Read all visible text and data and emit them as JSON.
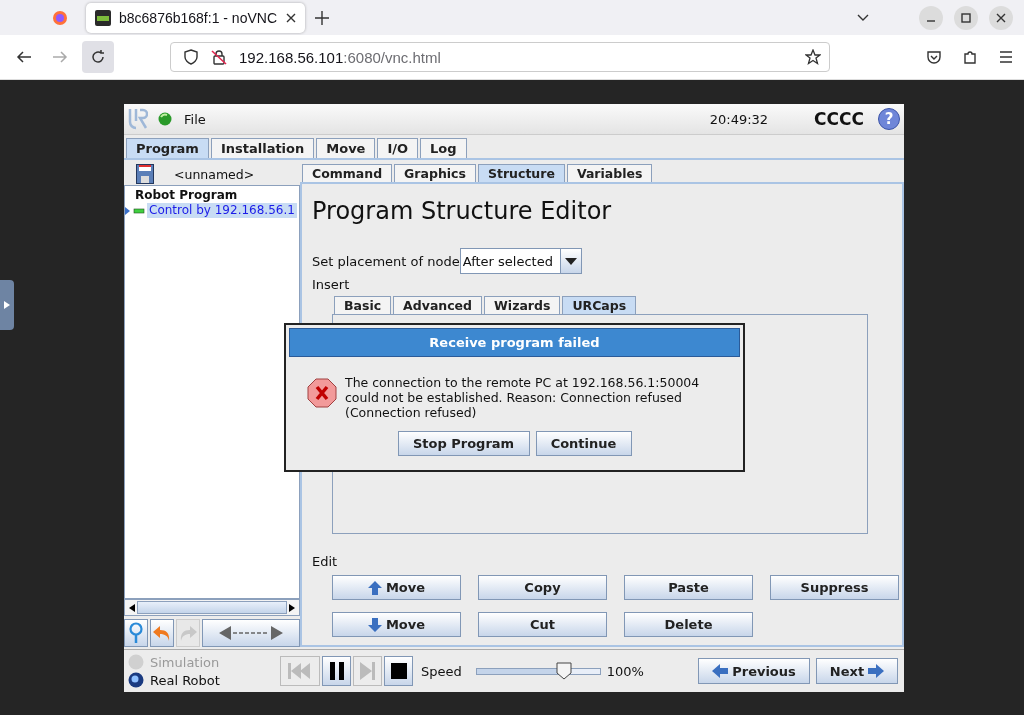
{
  "browser": {
    "tab_title": "b8c6876b168f:1 - noVNC",
    "url_host": "192.168.56.101",
    "url_rest": ":6080/vnc.html"
  },
  "header": {
    "menu": "File",
    "time": "20:49:32",
    "robot_name": "CCCC",
    "help": "?"
  },
  "main_tabs": [
    {
      "label": "Program",
      "selected": true
    },
    {
      "label": "Installation",
      "selected": false
    },
    {
      "label": "Move",
      "selected": false
    },
    {
      "label": "I/O",
      "selected": false
    },
    {
      "label": "Log",
      "selected": false
    }
  ],
  "program_name": "<unnamed>",
  "tree": [
    {
      "label": "Robot Program",
      "selected": false,
      "children": [
        {
          "label": "Control by 192.168.56.1",
          "selected": true
        }
      ]
    }
  ],
  "sub_tabs": [
    {
      "label": "Command",
      "selected": false
    },
    {
      "label": "Graphics",
      "selected": false
    },
    {
      "label": "Structure",
      "selected": true
    },
    {
      "label": "Variables",
      "selected": false
    }
  ],
  "editor": {
    "title": "Program Structure Editor",
    "placement_label": "Set placement of node",
    "placement_value": "After selected",
    "insert_label": "Insert",
    "edit_label": "Edit"
  },
  "insert_tabs": [
    {
      "label": "Basic",
      "selected": false
    },
    {
      "label": "Advanced",
      "selected": false
    },
    {
      "label": "Wizards",
      "selected": false
    },
    {
      "label": "URCaps",
      "selected": true
    }
  ],
  "edit_buttons": [
    {
      "label": "Move",
      "kind": "up"
    },
    {
      "label": "Copy",
      "kind": "plain"
    },
    {
      "label": "Paste",
      "kind": "plain"
    },
    {
      "label": "Suppress",
      "kind": "plain"
    },
    {
      "label": "Move",
      "kind": "down"
    },
    {
      "label": "Cut",
      "kind": "plain"
    },
    {
      "label": "Delete",
      "kind": "plain"
    }
  ],
  "modes": [
    {
      "label": "Simulation",
      "selected": false
    },
    {
      "label": "Real Robot",
      "selected": true
    }
  ],
  "playback": [
    {
      "kind": "rewind",
      "disabled": true
    },
    {
      "kind": "pause",
      "disabled": false
    },
    {
      "kind": "step",
      "disabled": true
    },
    {
      "kind": "stop",
      "disabled": false
    }
  ],
  "speed": {
    "label": "Speed",
    "level": 0.66,
    "reading": "100%"
  },
  "nav_buttons": [
    {
      "label": "Previous",
      "kind": "back"
    },
    {
      "label": "Next",
      "kind": "forward"
    }
  ],
  "dialog": {
    "title": "Receive program failed",
    "message": "The connection to the remote PC at 192.168.56.1:50004 could not be established. Reason: Connection refused (Connection refused)",
    "buttons": [
      "Stop Program",
      "Continue"
    ]
  }
}
